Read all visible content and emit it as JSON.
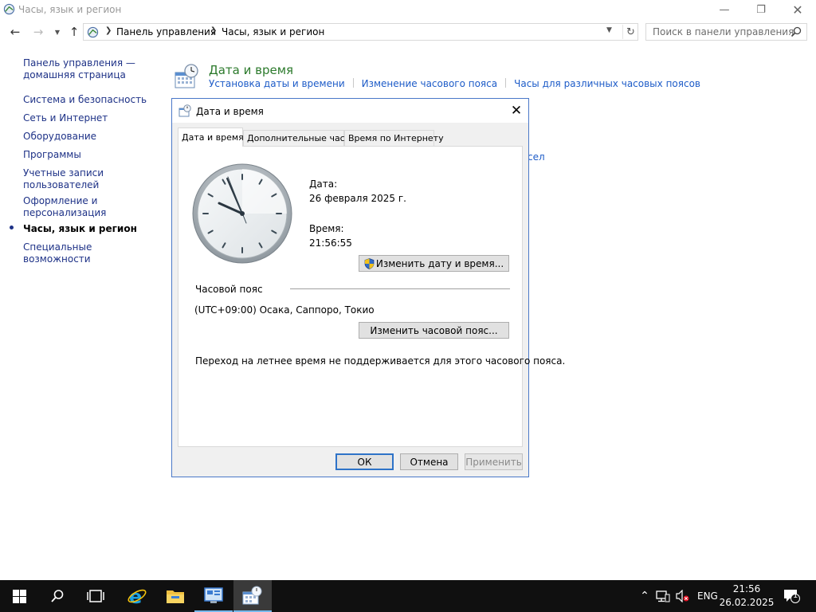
{
  "window": {
    "title": "Часы, язык и регион",
    "buttons": {
      "minimize": "—",
      "maximize": "❐",
      "close": "✕"
    }
  },
  "address_bar": {
    "crumbs": [
      "Панель управления",
      "Часы, язык и регион"
    ],
    "search_placeholder": "Поиск в панели управления"
  },
  "sidebar": {
    "items": [
      {
        "label": "Панель управления — домашняя страница"
      },
      {
        "label": "Система и безопасность"
      },
      {
        "label": "Сеть и Интернет"
      },
      {
        "label": "Оборудование"
      },
      {
        "label": "Программы"
      },
      {
        "label": "Учетные записи пользователей"
      },
      {
        "label": "Оформление и персонализация"
      },
      {
        "label": "Часы, язык и регион",
        "active": true
      },
      {
        "label": "Специальные возможности"
      }
    ]
  },
  "category": {
    "title": "Дата и время",
    "links": [
      "Установка даты и времени",
      "Изменение часового пояса",
      "Часы для различных часовых поясов"
    ],
    "partial_link": "сел"
  },
  "dialog": {
    "title": "Дата и время",
    "close": "✕",
    "tabs": [
      "Дата и время",
      "Дополнительные часы",
      "Время по Интернету"
    ],
    "date_label": "Дата:",
    "date_value": "26 февраля 2025 г.",
    "time_label": "Время:",
    "time_value": "21:56:55",
    "change_datetime_button": "Изменить дату и время...",
    "timezone_header": "Часовой пояс",
    "timezone_value": "(UTC+09:00) Осака, Саппоро, Токио",
    "change_timezone_button": "Изменить часовой пояс...",
    "dst_note": "Переход на летнее время не поддерживается для этого часового пояса.",
    "ok_button": "ОК",
    "cancel_button": "Отмена",
    "apply_button": "Применить"
  },
  "taskbar": {
    "language": "ENG",
    "time": "21:56",
    "date": "26.02.2025",
    "notification_count": "1"
  },
  "colors": {
    "link": "#1e5cc8",
    "category_title": "#2c7a2c",
    "taskbar": "#101010",
    "accent": "#2e73c8"
  }
}
